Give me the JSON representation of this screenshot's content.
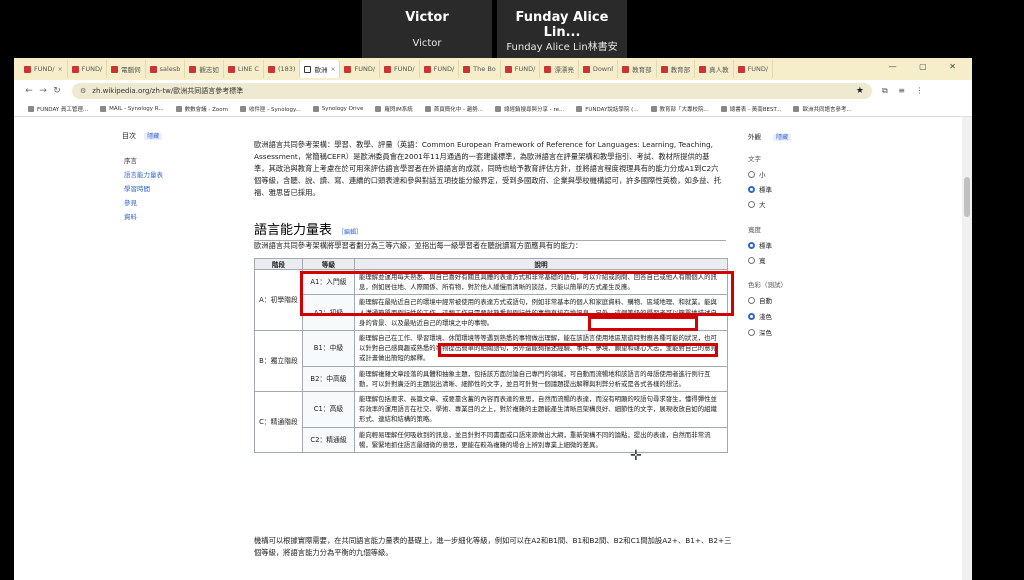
{
  "meeting": {
    "participants": [
      {
        "big": "Victor",
        "small": "Victor"
      },
      {
        "big": "Funday Alice Lin...",
        "small": "Funday Alice Lin林書安"
      }
    ]
  },
  "browser": {
    "tabs": [
      "FUND/",
      "FUND/",
      "電腦伺",
      "salesb",
      "觀志如",
      "LINE C",
      "(183) ",
      "歐洲",
      "FUND/",
      "FUND/",
      "FUND/",
      "The Bo",
      "FUND/",
      "漂漂亮",
      "Downl",
      "教育部",
      "教育部",
      "真人教",
      "FUND/"
    ],
    "url": "zh.wikipedia.org/zh-tw/歐洲共同語言參考標準",
    "bookmarks": [
      "FUNDAY 員工管理...",
      "MAIL - Synology R...",
      "數數會議 - Zoom",
      "收件匣 - Synology...",
      "Synology Drive",
      "羅閃IM系統",
      "首頁簡化中 - 趨勢...",
      "總經銷搜尋與分享 - re...",
      "FUNDAY說話學院 (...",
      "教育部「大專校院...",
      "總書表 - 黃南BEST...",
      "歐洲共同語言參考..."
    ]
  },
  "toc": {
    "title": "目次",
    "hide": "隱藏",
    "items": [
      "序言",
      "語言能力量表",
      "學習時間",
      "參見",
      "資料"
    ]
  },
  "options": {
    "title": "外觀",
    "hide": "隱藏",
    "text_label": "文字",
    "text_opts": [
      "小",
      "標準",
      "大"
    ],
    "width_label": "寬度",
    "width_opts": [
      "標準",
      "寬"
    ],
    "color_label": "色彩（測試）",
    "color_opts": [
      "自動",
      "淺色",
      "深色"
    ]
  },
  "article": {
    "intro_para": "歐洲語言共同參考架構：學習、教學、評量（英語：Common European Framework of Reference for Languages: Learning, Teaching, Assessment，常簡稱CEFR）是歐洲委員會在2001年11月通過的一套建議標準，為歐洲語言在評量架構和教學指引、考試、教材所提供的基準，其政治與教育上考慮在於可用來評估語言學習者在外語語言的成就，同時也給予教育評估方針，並將語言程度視理具有的能力分成A1到C2六個等級，含聽、說、讀、寫、連續的口頭表達和參與對話五項技能分級界定，受到多國政府、企業與學校機構認可，許多國際性英檢，如多益、托福、雅思皆已採用。",
    "h2": "語言能力量表",
    "edit": "［編輯］",
    "table_intro": "歐洲語言共同參考架構將學習者劃分為三等六級，並指出每一級學習者在聽說讀寫方面應具有的能力：",
    "headers": [
      "階段",
      "等級",
      "說明"
    ],
    "stages": [
      "A：初學階段",
      "B：獨立階段",
      "C：精通階段"
    ],
    "rows": [
      {
        "level": "A1：入門級",
        "desc": "能理解並運用每天熟悉、與自己喜好有關且具體的表達方式和非常基礎的語句，可以介紹或詢問、回答自己或他人有關個人的訊息，例如居住地、人際關係、所有物，對於他人緩慢而清晰的談話，只能以簡單的方式產生反應。"
      },
      {
        "level": "A2：初級",
        "desc": "能理解在最貼近自己的環境中經常被使用的表達方式或語句，例如非常基本的個人和家庭資料、購物、區域地理、和就業。能與人溝通簡單而例行性的工作，這類工作只需要就熟悉與例行性的事物直接交換訊息。另外，這個等級的學習者可以簡單地描述自身的背景、以及最貼近自己的環境之中的事物。"
      },
      {
        "level": "B1：中級",
        "desc": "能理解自己在工作、學習環境、休閒環境等等遇到熟悉的事物做出理解，能在該語言使用地區旅遊時對應各種可能的狀況，也可以針對自己感興趣或熟悉的事物提出簡單的相關語句，另外還能夠描述經驗、事件、夢境、願望和雄心大志，並能對自己的意見或計畫做出簡短的解釋。"
      },
      {
        "level": "B2：中高級",
        "desc": "能理解複雜文章段落的具體和抽象主題，包括該方面討論自己專門的領域，可自動而流暢地和該語言的母語使用者進行例行互動，可以針對廣泛的主題說出清晰、細節性的文字，並且可針對一個議題提出解釋與利弊分析或是各式各樣的想法。"
      },
      {
        "level": "C1：高級",
        "desc": "能理解包括要求、長篇文章、或要靠含蓄的內容而表達的意思，自然而流暢的表達，而沒有明顯的咬語句尋求發生，懂得彈性並有效率的運用語言在社交、學術、專業目的之上，對於複雜的主題能產生清晰且架構良好、細節性的文字，展現收放自如的組織形式、連結和結構的策略。"
      },
      {
        "level": "C2：精通級",
        "desc": "能向輕易理解任何吸收到的訊息，並且針對不同書面或口語來源做出大綱，重新架構不同的論點，提出的表達，自然而非常流暢，緊緊地抓住語言最細微的意思，更能在較為複雜的場合上辨別專業上細微的差異。"
      }
    ],
    "footer_para": "機構可以根據實際需要，在共同語言能力量表的基礎上，進一步細化等級，例如可以在A2和B1間、B1和B2間、B2和C1間加設A2+、B1+、B2+三個等級，將語言能力分為平衡的九個等級。"
  }
}
